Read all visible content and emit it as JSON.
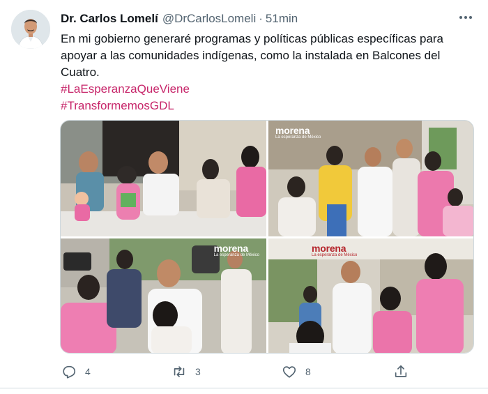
{
  "author": {
    "name": "Dr. Carlos Lomelí",
    "handle": "@DrCarlosLomeli",
    "separator": "·",
    "time": "51min"
  },
  "tweet": {
    "text": "En mi gobierno generaré programas y políticas públicas específicas para apoyar a las comunidades indígenas, como la instalada en Balcones del Cuatro.",
    "hashtags": [
      "#LaEsperanzaQueViene",
      "#TransformemosGDL"
    ]
  },
  "media": {
    "logo_text": "morena",
    "logo_subtext": "La esperanza de México"
  },
  "actions": {
    "reply_count": "4",
    "retweet_count": "3",
    "like_count": "8"
  },
  "colors": {
    "hashtag": "#c7266a",
    "muted": "#536471",
    "morena": "#b5252c"
  },
  "icons": [
    "more-icon",
    "reply-icon",
    "retweet-icon",
    "like-icon",
    "share-icon"
  ]
}
